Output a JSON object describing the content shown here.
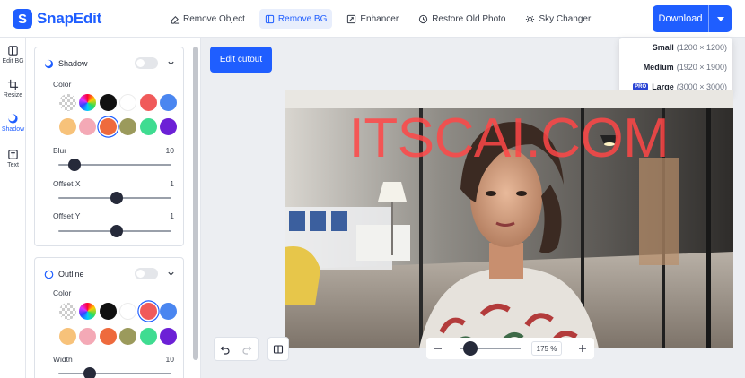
{
  "header": {
    "brand_mark": "S",
    "brand_name": "SnapEdit",
    "nav": [
      {
        "label": "Remove Object",
        "icon": "eraser-icon",
        "active": false
      },
      {
        "label": "Remove BG",
        "icon": "remove-bg-icon",
        "active": true
      },
      {
        "label": "Enhancer",
        "icon": "enhancer-icon",
        "active": false
      },
      {
        "label": "Restore Old Photo",
        "icon": "restore-icon",
        "active": false
      },
      {
        "label": "Sky Changer",
        "icon": "sky-icon",
        "active": false
      }
    ],
    "download_label": "Download",
    "accent_color": "#1f5eff"
  },
  "download_menu": {
    "items": [
      {
        "size": "Small",
        "dims": "(1200 × 1200)",
        "pro": false
      },
      {
        "size": "Medium",
        "dims": "(1920 × 1900)",
        "pro": false
      },
      {
        "size": "Large",
        "dims": "(3000 × 3000)",
        "pro": true,
        "badge": "PRO"
      }
    ]
  },
  "tool_rail": {
    "items": [
      {
        "label": "Edit BG",
        "icon": "edit-bg-icon",
        "active": false
      },
      {
        "label": "Resize",
        "icon": "crop-icon",
        "active": false
      },
      {
        "label": "Shadow",
        "icon": "shadow-icon",
        "active": true
      },
      {
        "label": "Text",
        "icon": "text-icon",
        "active": false
      }
    ]
  },
  "shadow": {
    "title": "Shadow",
    "enabled": false,
    "color_label": "Color",
    "colors_row1": [
      "transparent",
      "rainbow",
      "#111111",
      "#ffffff",
      "#f05a5a",
      "#4a86f0"
    ],
    "colors_row2": [
      "#f7c27a",
      "#f4a9b6",
      "#ee6a3d",
      "#9b9a5c",
      "#3fdc91",
      "#6c20d6"
    ],
    "selected_color": "#ee6a3d",
    "blur_label": "Blur",
    "blur_value": "10",
    "blur_level": 0.1,
    "offset_x_label": "Offset X",
    "offset_x_value": "1",
    "offset_x_level": 0.52,
    "offset_y_label": "Offset Y",
    "offset_y_value": "1",
    "offset_y_level": 0.52
  },
  "outline": {
    "title": "Outline",
    "enabled": false,
    "color_label": "Color",
    "colors_row1": [
      "transparent",
      "rainbow",
      "#111111",
      "#ffffff",
      "#f05a5a",
      "#4a86f0"
    ],
    "colors_row2": [
      "#f7c27a",
      "#f4a9b6",
      "#ee6a3d",
      "#9b9a5c",
      "#3fdc91",
      "#6c20d6"
    ],
    "selected_color": "#f05a5a",
    "width_label": "Width",
    "width_value": "10",
    "width_level": 0.25
  },
  "canvas": {
    "edit_cutout_label": "Edit cutout",
    "watermark": "ITSCAI.COM",
    "zoom_value": "175 %",
    "zoom_level": 0.14
  }
}
